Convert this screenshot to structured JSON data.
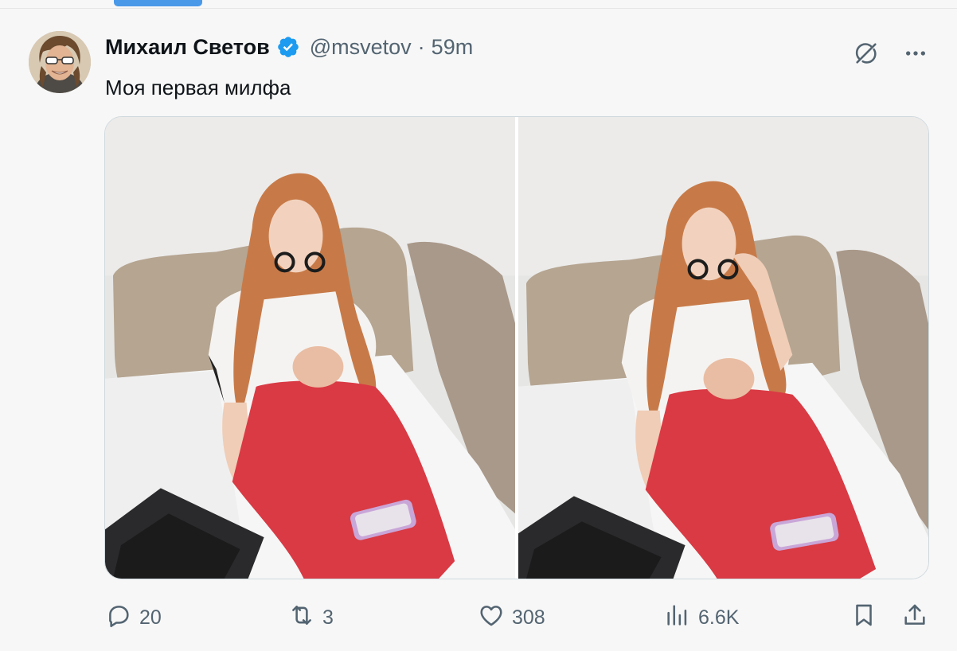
{
  "tweet": {
    "author_name": "Михаил Светов",
    "handle": "@msvetov",
    "separator": "·",
    "time": "59m",
    "text": "Моя первая милфа"
  },
  "actions": {
    "replies": "20",
    "reposts": "3",
    "likes": "308",
    "views": "6.6K"
  },
  "colors": {
    "accent": "#1d9bf0",
    "muted": "#536471",
    "text": "#0f1419"
  },
  "icons": [
    "grok-icon",
    "more-icon",
    "reply-icon",
    "repost-icon",
    "like-icon",
    "views-icon",
    "bookmark-icon",
    "share-icon",
    "verified-badge-icon"
  ]
}
